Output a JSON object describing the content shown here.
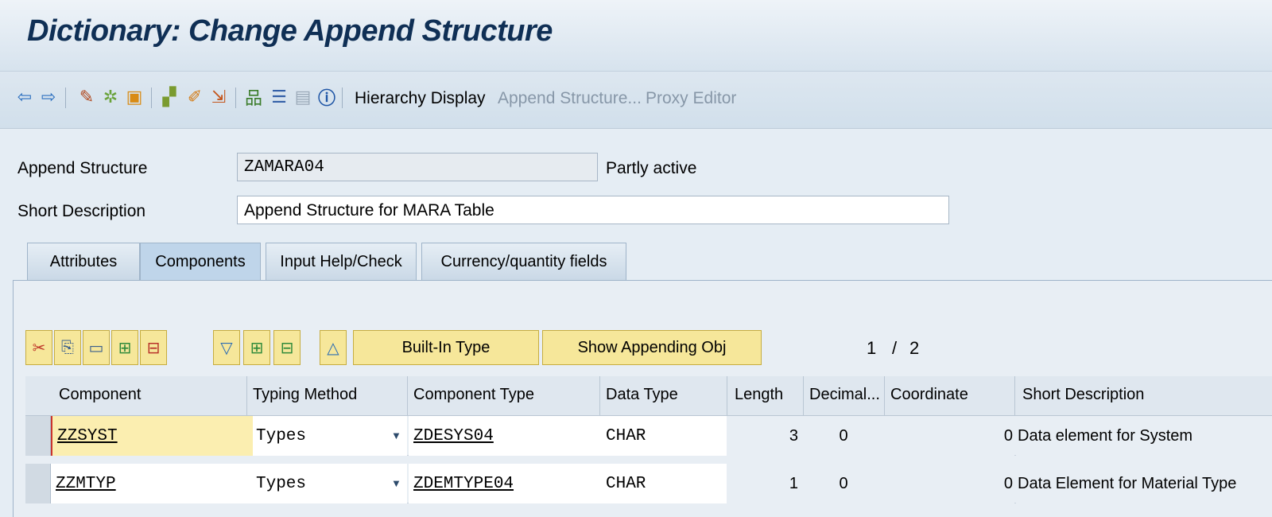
{
  "window": {
    "title": "Dictionary: Change Append Structure"
  },
  "toolbar": {
    "icons": [
      "back-icon",
      "forward-icon",
      "display-change-icon",
      "activate-icon",
      "other-object-icon",
      "check-icon",
      "magic-wand-icon",
      "where-used-icon",
      "hierarchy-icon",
      "object-list-icon",
      "documentation-icon",
      "info-icon"
    ],
    "hierarchy_display": "Hierarchy Display",
    "append_structure": "Append Structure...",
    "proxy_editor": "Proxy Editor"
  },
  "header": {
    "append_structure_label": "Append Structure",
    "append_structure_value": "ZAMARA04",
    "status": "Partly active",
    "short_description_label": "Short Description",
    "short_description_value": "Append Structure for MARA Table"
  },
  "tabs": [
    {
      "label": "Attributes"
    },
    {
      "label": "Components"
    },
    {
      "label": "Input Help/Check"
    },
    {
      "label": "Currency/quantity fields"
    }
  ],
  "grid_toolbar": {
    "built_in_type": "Built-In Type",
    "show_appending_obj": "Show Appending Obj",
    "page": "1",
    "page_sep": "/",
    "page_total": "2"
  },
  "table": {
    "columns": [
      "Component",
      "Typing Method",
      "Component Type",
      "Data Type",
      "Length",
      "Decimal...",
      "Coordinate",
      "Short Description"
    ],
    "rows": [
      {
        "component": "ZZSYST",
        "typing": "Types",
        "comp_type": "ZDESYS04",
        "data_type": "CHAR",
        "length": "3",
        "decimals": "0",
        "coordinate": "0",
        "short_desc": "Data element for System"
      },
      {
        "component": "ZZMTYP",
        "typing": "Types",
        "comp_type": "ZDEMTYPE04",
        "data_type": "CHAR",
        "length": "1",
        "decimals": "0",
        "coordinate": "0",
        "short_desc": "Data Element for Material Type"
      }
    ]
  }
}
